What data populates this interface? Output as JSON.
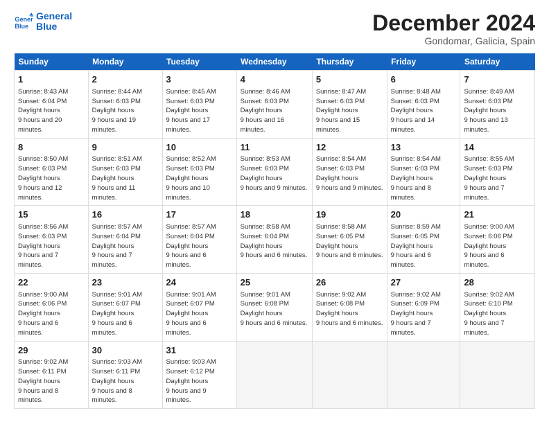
{
  "logo": {
    "line1": "General",
    "line2": "Blue"
  },
  "title": "December 2024",
  "location": "Gondomar, Galicia, Spain",
  "headers": [
    "Sunday",
    "Monday",
    "Tuesday",
    "Wednesday",
    "Thursday",
    "Friday",
    "Saturday"
  ],
  "weeks": [
    [
      {
        "day": "1",
        "sunrise": "8:43 AM",
        "sunset": "6:04 PM",
        "daylight": "9 hours and 20 minutes."
      },
      {
        "day": "2",
        "sunrise": "8:44 AM",
        "sunset": "6:03 PM",
        "daylight": "9 hours and 19 minutes."
      },
      {
        "day": "3",
        "sunrise": "8:45 AM",
        "sunset": "6:03 PM",
        "daylight": "9 hours and 17 minutes."
      },
      {
        "day": "4",
        "sunrise": "8:46 AM",
        "sunset": "6:03 PM",
        "daylight": "9 hours and 16 minutes."
      },
      {
        "day": "5",
        "sunrise": "8:47 AM",
        "sunset": "6:03 PM",
        "daylight": "9 hours and 15 minutes."
      },
      {
        "day": "6",
        "sunrise": "8:48 AM",
        "sunset": "6:03 PM",
        "daylight": "9 hours and 14 minutes."
      },
      {
        "day": "7",
        "sunrise": "8:49 AM",
        "sunset": "6:03 PM",
        "daylight": "9 hours and 13 minutes."
      }
    ],
    [
      {
        "day": "8",
        "sunrise": "8:50 AM",
        "sunset": "6:03 PM",
        "daylight": "9 hours and 12 minutes."
      },
      {
        "day": "9",
        "sunrise": "8:51 AM",
        "sunset": "6:03 PM",
        "daylight": "9 hours and 11 minutes."
      },
      {
        "day": "10",
        "sunrise": "8:52 AM",
        "sunset": "6:03 PM",
        "daylight": "9 hours and 10 minutes."
      },
      {
        "day": "11",
        "sunrise": "8:53 AM",
        "sunset": "6:03 PM",
        "daylight": "9 hours and 9 minutes."
      },
      {
        "day": "12",
        "sunrise": "8:54 AM",
        "sunset": "6:03 PM",
        "daylight": "9 hours and 9 minutes."
      },
      {
        "day": "13",
        "sunrise": "8:54 AM",
        "sunset": "6:03 PM",
        "daylight": "9 hours and 8 minutes."
      },
      {
        "day": "14",
        "sunrise": "8:55 AM",
        "sunset": "6:03 PM",
        "daylight": "9 hours and 7 minutes."
      }
    ],
    [
      {
        "day": "15",
        "sunrise": "8:56 AM",
        "sunset": "6:03 PM",
        "daylight": "9 hours and 7 minutes."
      },
      {
        "day": "16",
        "sunrise": "8:57 AM",
        "sunset": "6:04 PM",
        "daylight": "9 hours and 7 minutes."
      },
      {
        "day": "17",
        "sunrise": "8:57 AM",
        "sunset": "6:04 PM",
        "daylight": "9 hours and 6 minutes."
      },
      {
        "day": "18",
        "sunrise": "8:58 AM",
        "sunset": "6:04 PM",
        "daylight": "9 hours and 6 minutes."
      },
      {
        "day": "19",
        "sunrise": "8:58 AM",
        "sunset": "6:05 PM",
        "daylight": "9 hours and 6 minutes."
      },
      {
        "day": "20",
        "sunrise": "8:59 AM",
        "sunset": "6:05 PM",
        "daylight": "9 hours and 6 minutes."
      },
      {
        "day": "21",
        "sunrise": "9:00 AM",
        "sunset": "6:06 PM",
        "daylight": "9 hours and 6 minutes."
      }
    ],
    [
      {
        "day": "22",
        "sunrise": "9:00 AM",
        "sunset": "6:06 PM",
        "daylight": "9 hours and 6 minutes."
      },
      {
        "day": "23",
        "sunrise": "9:01 AM",
        "sunset": "6:07 PM",
        "daylight": "9 hours and 6 minutes."
      },
      {
        "day": "24",
        "sunrise": "9:01 AM",
        "sunset": "6:07 PM",
        "daylight": "9 hours and 6 minutes."
      },
      {
        "day": "25",
        "sunrise": "9:01 AM",
        "sunset": "6:08 PM",
        "daylight": "9 hours and 6 minutes."
      },
      {
        "day": "26",
        "sunrise": "9:02 AM",
        "sunset": "6:08 PM",
        "daylight": "9 hours and 6 minutes."
      },
      {
        "day": "27",
        "sunrise": "9:02 AM",
        "sunset": "6:09 PM",
        "daylight": "9 hours and 7 minutes."
      },
      {
        "day": "28",
        "sunrise": "9:02 AM",
        "sunset": "6:10 PM",
        "daylight": "9 hours and 7 minutes."
      }
    ],
    [
      {
        "day": "29",
        "sunrise": "9:02 AM",
        "sunset": "6:11 PM",
        "daylight": "9 hours and 8 minutes."
      },
      {
        "day": "30",
        "sunrise": "9:03 AM",
        "sunset": "6:11 PM",
        "daylight": "9 hours and 8 minutes."
      },
      {
        "day": "31",
        "sunrise": "9:03 AM",
        "sunset": "6:12 PM",
        "daylight": "9 hours and 9 minutes."
      },
      null,
      null,
      null,
      null
    ]
  ]
}
